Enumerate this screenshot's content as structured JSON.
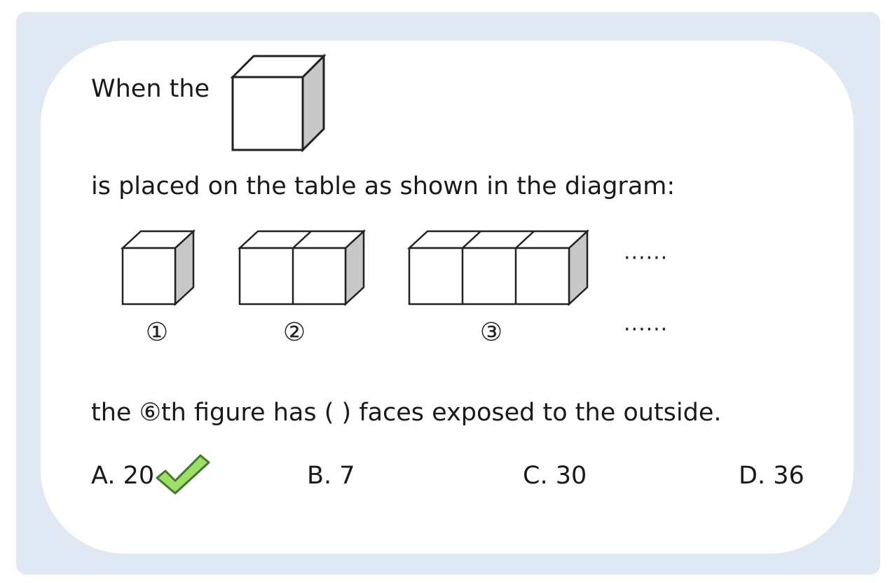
{
  "question": {
    "line1": "When the",
    "line2": "is placed on the table as shown in the diagram:",
    "line3": "the ⑥th figure has ( ) faces exposed to the outside."
  },
  "diagram": {
    "labels": [
      "①",
      "②",
      "③"
    ],
    "ellipsis_top": "······",
    "ellipsis_bottom": "······"
  },
  "options": [
    {
      "label": "A. 20",
      "correct": true
    },
    {
      "label": "B. 7",
      "correct": false
    },
    {
      "label": "C. 30",
      "correct": false
    },
    {
      "label": "D. 36",
      "correct": false
    }
  ],
  "colors": {
    "frame": "#dfe8f3",
    "card": "#ffffff",
    "cube_side": "#c8c8c8",
    "check_fill": "#9fdc68",
    "check_stroke": "#3f7a2a"
  }
}
